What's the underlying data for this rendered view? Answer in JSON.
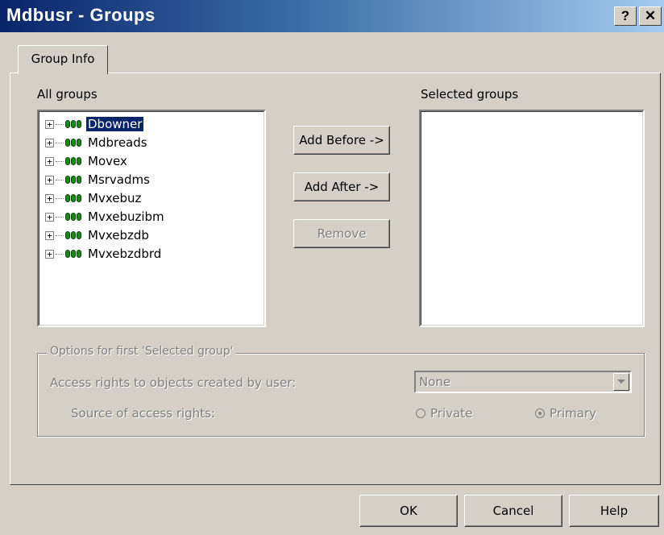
{
  "window": {
    "title": "Mdbusr - Groups",
    "help_glyph": "?",
    "close_glyph": "✕"
  },
  "tabs": [
    {
      "label": "Group Info"
    }
  ],
  "all_groups": {
    "label": "All groups",
    "items": [
      {
        "name": "Dbowner",
        "selected": true
      },
      {
        "name": "Mdbreads",
        "selected": false
      },
      {
        "name": "Movex",
        "selected": false
      },
      {
        "name": "Msrvadms",
        "selected": false
      },
      {
        "name": "Mvxebuz",
        "selected": false
      },
      {
        "name": "Mvxebuzibm",
        "selected": false
      },
      {
        "name": "Mvxebzdb",
        "selected": false
      },
      {
        "name": "Mvxebzdbrd",
        "selected": false
      }
    ]
  },
  "actions": {
    "add_before": "Add Before ->",
    "add_after": "Add After ->",
    "remove": "Remove"
  },
  "selected_groups": {
    "label": "Selected groups",
    "items": []
  },
  "options": {
    "group_label": "Options for first 'Selected group'",
    "access_rights_label": "Access rights to objects created by user:",
    "access_rights_value": "None",
    "source_label": "Source of access rights:",
    "radio_private": "Private",
    "radio_primary": "Primary",
    "selected_radio": "Primary"
  },
  "footer": {
    "ok": "OK",
    "cancel": "Cancel",
    "help": "Help"
  },
  "colors": {
    "title_gradient_start": "#0a246a",
    "title_gradient_end": "#a6caf0",
    "face": "#d4d0c8",
    "selection": "#0a246a",
    "group_icon": "#1a8a1a"
  },
  "icons": [
    "help-icon",
    "close-icon",
    "expand-plus-icon",
    "group-icon",
    "dropdown-arrow-icon"
  ]
}
